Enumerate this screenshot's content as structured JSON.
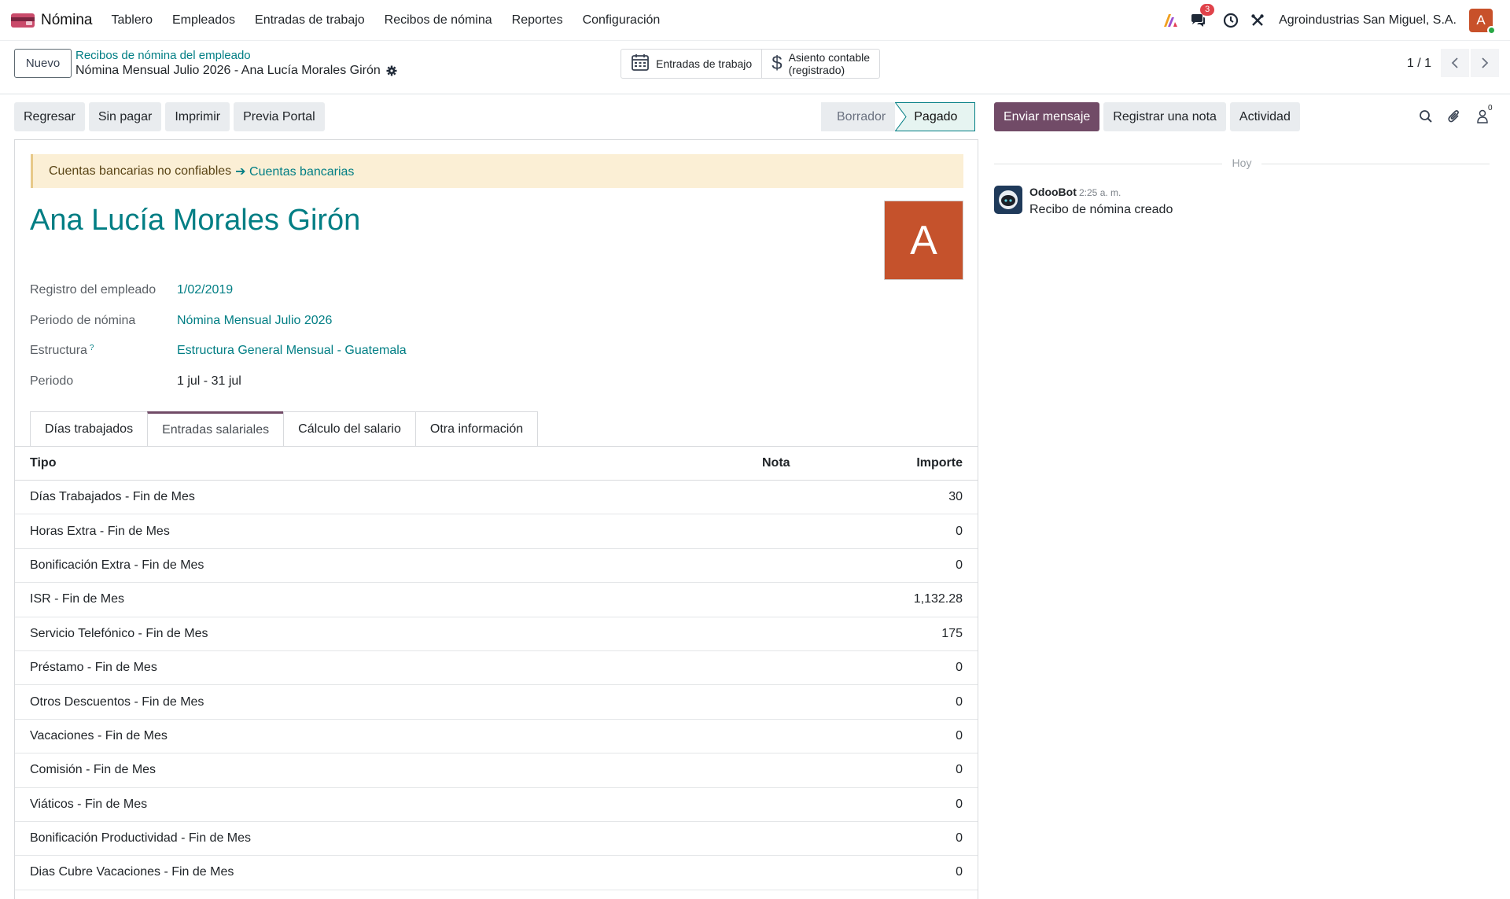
{
  "navbar": {
    "app_name": "Nómina",
    "menu": [
      "Tablero",
      "Empleados",
      "Entradas de trabajo",
      "Recibos de nómina",
      "Reportes",
      "Configuración"
    ],
    "messages_count": "3",
    "company": "Agroindustrias San Miguel, S.A.",
    "user_initial": "A",
    "icons": [
      "ai-icon",
      "chat-icon",
      "clock-icon",
      "tools-icon"
    ]
  },
  "control": {
    "new_label": "Nuevo",
    "breadcrumb_parent": "Recibos de nómina del empleado",
    "breadcrumb_current": "Nómina Mensual Julio 2026 - Ana Lucía Morales Girón",
    "smart_work_entries": "Entradas de trabajo",
    "smart_entry_line1": "Asiento contable",
    "smart_entry_line2": "(registrado)",
    "pager": "1 / 1"
  },
  "actions": {
    "buttons": [
      "Regresar",
      "Sin pagar",
      "Imprimir",
      "Previa Portal"
    ],
    "status_draft": "Borrador",
    "status_paid": "Pagado"
  },
  "sheet": {
    "alert_text": "Cuentas bancarias no confiables",
    "alert_link": "➔ Cuentas bancarias",
    "employee_name": "Ana Lucía Morales Girón",
    "avatar_initial": "A",
    "fields": {
      "registro_label": "Registro del empleado",
      "registro_value": "1/02/2019",
      "periodo_nomina_label": "Periodo de nómina",
      "periodo_nomina_value": "Nómina Mensual Julio 2026",
      "estructura_label": "Estructura",
      "estructura_help": "?",
      "estructura_value": "Estructura General Mensual - Guatemala",
      "periodo_label": "Periodo",
      "periodo_value": "1 jul - 31 jul"
    },
    "tabs": [
      "Días trabajados",
      "Entradas salariales",
      "Cálculo del salario",
      "Otra información"
    ],
    "active_tab": "Entradas salariales",
    "table": {
      "headers": {
        "type": "Tipo",
        "note": "Nota",
        "amount": "Importe"
      },
      "rows": [
        {
          "type": "Días Trabajados - Fin de Mes",
          "note": "",
          "amount": "30"
        },
        {
          "type": "Horas Extra - Fin de Mes",
          "note": "",
          "amount": "0"
        },
        {
          "type": "Bonificación Extra - Fin de Mes",
          "note": "",
          "amount": "0"
        },
        {
          "type": "ISR - Fin de Mes",
          "note": "",
          "amount": "1,132.28"
        },
        {
          "type": "Servicio Telefónico - Fin de Mes",
          "note": "",
          "amount": "175"
        },
        {
          "type": "Préstamo - Fin de Mes",
          "note": "",
          "amount": "0"
        },
        {
          "type": "Otros Descuentos - Fin de Mes",
          "note": "",
          "amount": "0"
        },
        {
          "type": "Vacaciones - Fin de Mes",
          "note": "",
          "amount": "0"
        },
        {
          "type": "Comisión - Fin de Mes",
          "note": "",
          "amount": "0"
        },
        {
          "type": "Viáticos - Fin de Mes",
          "note": "",
          "amount": "0"
        },
        {
          "type": "Bonificación Productividad - Fin de Mes",
          "note": "",
          "amount": "0"
        },
        {
          "type": "Dias Cubre Vacaciones - Fin de Mes",
          "note": "",
          "amount": "0"
        }
      ]
    }
  },
  "chatter": {
    "send_message": "Enviar mensaje",
    "log_note": "Registrar una nota",
    "activity": "Actividad",
    "followers_count": "0",
    "date_separator": "Hoy",
    "message": {
      "author": "OdooBot",
      "time": "2:25 a. m.",
      "body": "Recibo de nómina creado"
    }
  },
  "colors": {
    "primary": "#714b67",
    "link": "#017e84",
    "alert_bg": "#fbefd5",
    "avatar": "#c5522c"
  }
}
